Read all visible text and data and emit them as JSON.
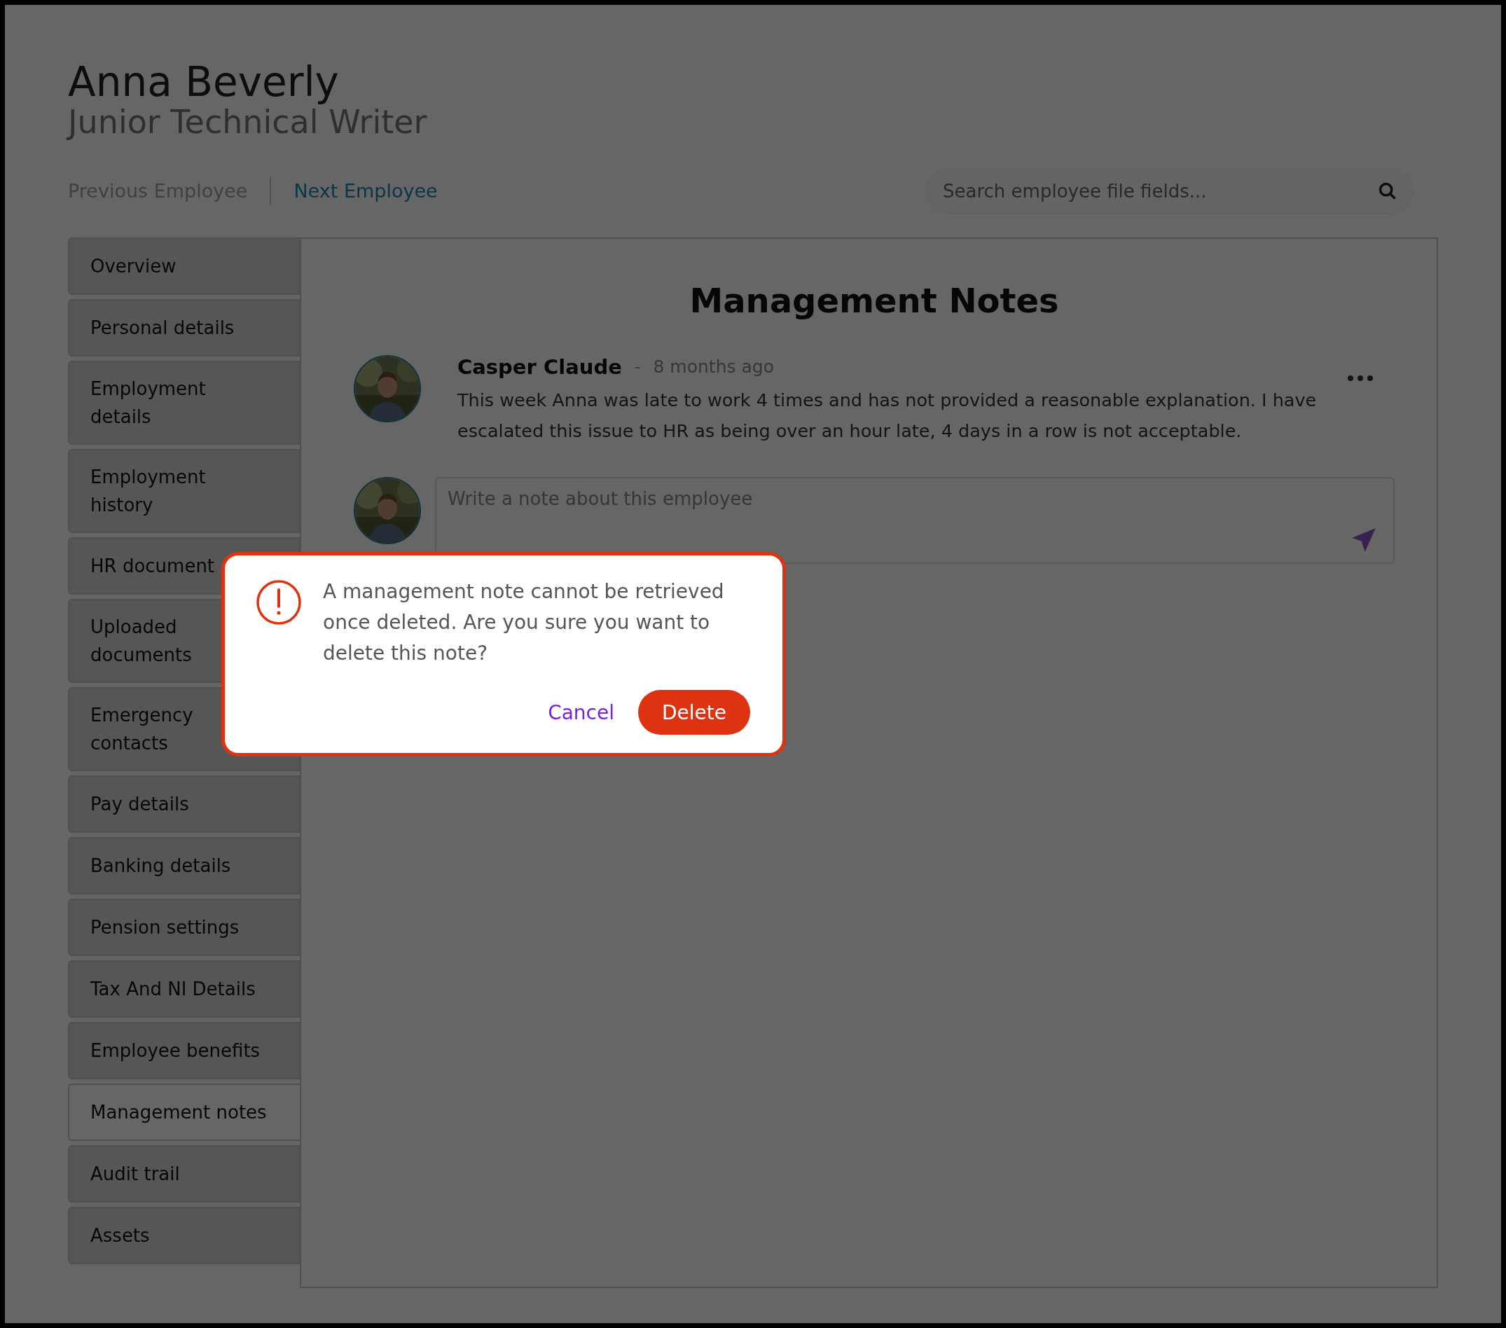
{
  "employee": {
    "name": "Anna Beverly",
    "role": "Junior Technical Writer"
  },
  "nav": [
    {
      "label": "Previous Employee",
      "disabled": true
    },
    {
      "label": "Next Employee",
      "disabled": false
    }
  ],
  "search": {
    "placeholder": "Search employee file fields..."
  },
  "sidebar": {
    "items": [
      {
        "label": "Overview",
        "selected": false
      },
      {
        "label": "Personal details",
        "selected": false
      },
      {
        "label": "Employment details",
        "selected": false
      },
      {
        "label": "Employment history",
        "selected": false
      },
      {
        "label": "HR document",
        "selected": false
      },
      {
        "label": "Uploaded documents",
        "selected": false
      },
      {
        "label": "Emergency contacts",
        "selected": false
      },
      {
        "label": "Pay details",
        "selected": false
      },
      {
        "label": "Banking details",
        "selected": false
      },
      {
        "label": "Pension settings",
        "selected": false
      },
      {
        "label": "Tax And NI Details",
        "selected": false
      },
      {
        "label": "Employee benefits",
        "selected": false
      },
      {
        "label": "Management notes",
        "selected": true
      },
      {
        "label": "Audit trail",
        "selected": false
      },
      {
        "label": "Assets",
        "selected": false
      }
    ]
  },
  "content": {
    "title": "Management Notes",
    "notes": [
      {
        "author": "Casper Claude",
        "separator": "-",
        "time": "8 months ago",
        "text": "This week Anna was late to work 4 times and has not provided a reasonable explanation. I have escalated this issue to HR as being over an hour late, 4 days in a row is not acceptable."
      }
    ],
    "composer": {
      "placeholder": "Write a note about this employee"
    }
  },
  "dialog": {
    "message": "A management note cannot be retrieved once deleted. Are you sure you want to delete this note?",
    "buttons": [
      {
        "label": "Cancel",
        "kind": "link"
      },
      {
        "label": "Delete",
        "kind": "danger"
      }
    ]
  }
}
